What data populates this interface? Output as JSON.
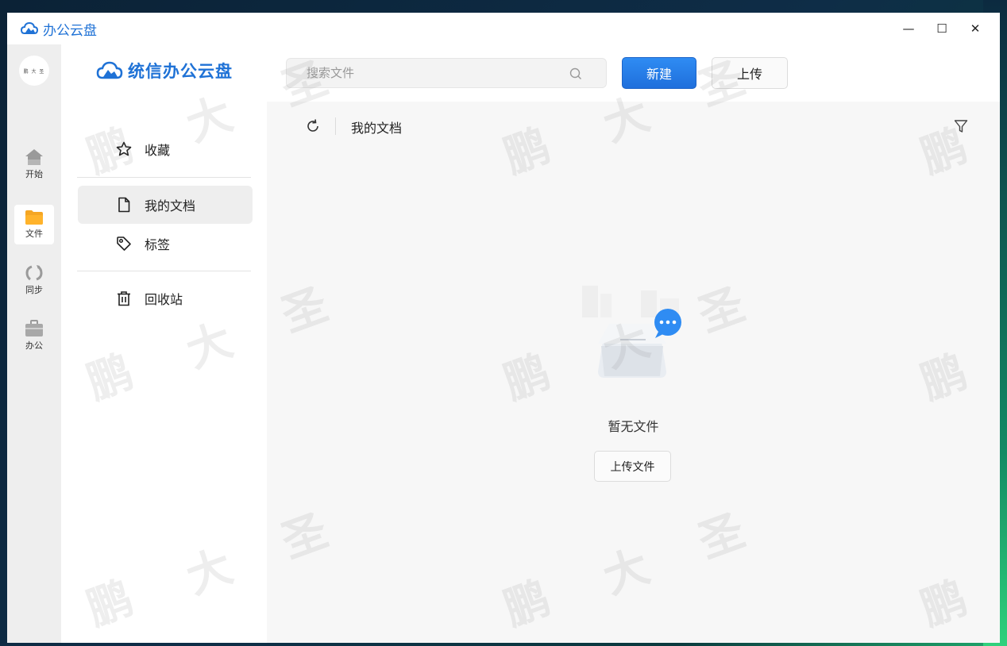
{
  "window": {
    "title": "办公云盘"
  },
  "window_controls": {
    "minimize": "—",
    "maximize": "☐",
    "close": "✕"
  },
  "rail": {
    "avatar_text": "鹏 大 圣",
    "items": [
      {
        "label": "开始",
        "icon": "home-icon"
      },
      {
        "label": "文件",
        "icon": "folder-icon"
      },
      {
        "label": "同步",
        "icon": "sync-icon"
      },
      {
        "label": "办公",
        "icon": "briefcase-icon"
      }
    ]
  },
  "sidebar": {
    "brand": "统信办公云盘",
    "items": [
      {
        "label": "收藏",
        "icon": "star-icon"
      },
      {
        "label": "我的文档",
        "icon": "document-icon"
      },
      {
        "label": "标签",
        "icon": "tag-icon"
      },
      {
        "label": "回收站",
        "icon": "trash-icon"
      }
    ]
  },
  "toolbar": {
    "search_placeholder": "搜索文件",
    "new_label": "新建",
    "upload_label": "上传"
  },
  "main": {
    "breadcrumb": "我的文档",
    "empty_text": "暂无文件",
    "upload_file_label": "上传文件"
  },
  "watermark": {
    "chars": [
      "鹏",
      "大",
      "圣"
    ]
  },
  "colors": {
    "accent": "#1f72d6",
    "active_folder": "#f5a623",
    "rail_bg": "#eeeeee",
    "main_bg": "#f7f7f7"
  }
}
